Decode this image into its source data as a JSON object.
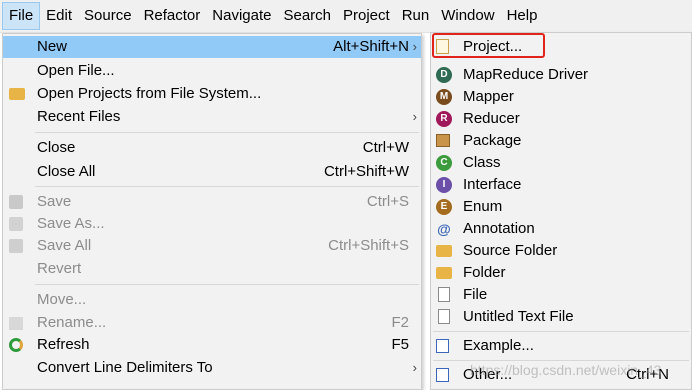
{
  "menubar": {
    "items": [
      "File",
      "Edit",
      "Source",
      "Refactor",
      "Navigate",
      "Search",
      "Project",
      "Run",
      "Window",
      "Help"
    ]
  },
  "file_menu": {
    "new": {
      "label": "New",
      "shortcut": "Alt+Shift+N"
    },
    "open_file": {
      "label": "Open File..."
    },
    "open_projects": {
      "label": "Open Projects from File System..."
    },
    "recent_files": {
      "label": "Recent Files"
    },
    "close": {
      "label": "Close",
      "shortcut": "Ctrl+W"
    },
    "close_all": {
      "label": "Close All",
      "shortcut": "Ctrl+Shift+W"
    },
    "save": {
      "label": "Save",
      "shortcut": "Ctrl+S"
    },
    "save_as": {
      "label": "Save As..."
    },
    "save_all": {
      "label": "Save All",
      "shortcut": "Ctrl+Shift+S"
    },
    "revert": {
      "label": "Revert"
    },
    "move": {
      "label": "Move..."
    },
    "rename": {
      "label": "Rename...",
      "shortcut": "F2"
    },
    "refresh": {
      "label": "Refresh",
      "shortcut": "F5"
    },
    "convert": {
      "label": "Convert Line Delimiters To"
    }
  },
  "new_menu": {
    "project": "Project...",
    "mapreduce_driver": "MapReduce Driver",
    "mapper": "Mapper",
    "reducer": "Reducer",
    "package": "Package",
    "class": "Class",
    "interface": "Interface",
    "enum": "Enum",
    "annotation": "Annotation",
    "source_folder": "Source Folder",
    "folder": "Folder",
    "file": "File",
    "untitled_text_file": "Untitled Text File",
    "example": "Example...",
    "other": {
      "label": "Other...",
      "shortcut": "Ctrl+N"
    }
  },
  "watermark": "https://blog.csdn.net/weixin_43"
}
